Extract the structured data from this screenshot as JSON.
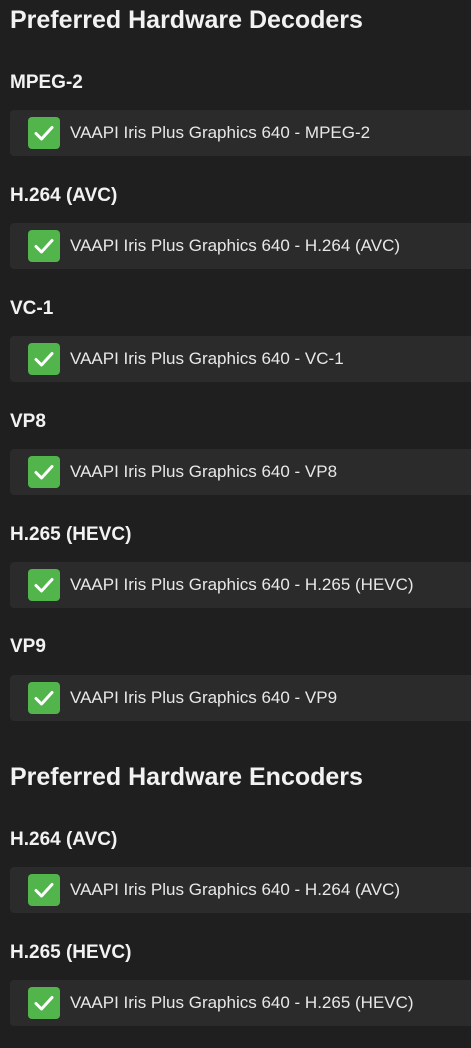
{
  "decoders": {
    "title": "Preferred Hardware Decoders",
    "items": [
      {
        "codec": "MPEG-2",
        "option": "VAAPI Iris Plus Graphics 640 - MPEG-2",
        "checked": true
      },
      {
        "codec": "H.264 (AVC)",
        "option": "VAAPI Iris Plus Graphics 640 - H.264 (AVC)",
        "checked": true
      },
      {
        "codec": "VC-1",
        "option": "VAAPI Iris Plus Graphics 640 - VC-1",
        "checked": true
      },
      {
        "codec": "VP8",
        "option": "VAAPI Iris Plus Graphics 640 - VP8",
        "checked": true
      },
      {
        "codec": "H.265 (HEVC)",
        "option": "VAAPI Iris Plus Graphics 640 - H.265 (HEVC)",
        "checked": true
      },
      {
        "codec": "VP9",
        "option": "VAAPI Iris Plus Graphics 640 - VP9",
        "checked": true
      }
    ]
  },
  "encoders": {
    "title": "Preferred Hardware Encoders",
    "items": [
      {
        "codec": "H.264 (AVC)",
        "option": "VAAPI Iris Plus Graphics 640 - H.264 (AVC)",
        "checked": true
      },
      {
        "codec": "H.265 (HEVC)",
        "option": "VAAPI Iris Plus Graphics 640 - H.265 (HEVC)",
        "checked": true
      }
    ]
  },
  "colors": {
    "background": "#1f1f1f",
    "row_background": "#2b2b2b",
    "checkbox_green": "#52b54b"
  },
  "icons": {
    "checkbox": "checkmark-icon"
  }
}
